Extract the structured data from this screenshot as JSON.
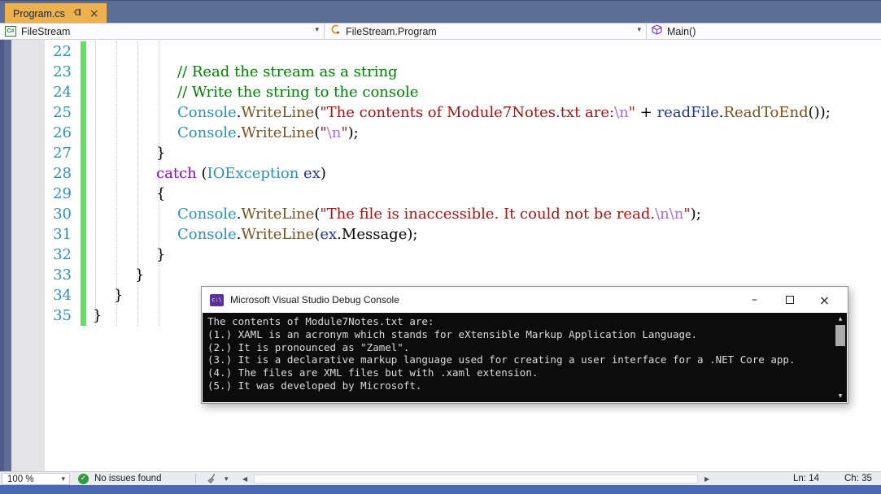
{
  "tab_bar": {
    "tabs": [
      {
        "label": "Program.cs",
        "active": true
      }
    ]
  },
  "navbar": {
    "project": "FileStream",
    "type": "FileStream.Program",
    "member": "Main()"
  },
  "editor": {
    "lines": [
      {
        "num": "22",
        "indent": 0,
        "tokens": []
      },
      {
        "num": "23",
        "indent": 16,
        "tokens": [
          {
            "c": "comment",
            "t": "// Read the stream as a string"
          }
        ]
      },
      {
        "num": "24",
        "indent": 16,
        "tokens": [
          {
            "c": "comment",
            "t": "// Write the string to the console"
          }
        ]
      },
      {
        "num": "25",
        "indent": 16,
        "tokens": [
          {
            "c": "type",
            "t": "Console"
          },
          {
            "c": "plain",
            "t": "."
          },
          {
            "c": "method",
            "t": "WriteLine"
          },
          {
            "c": "plain",
            "t": "("
          },
          {
            "c": "string",
            "t": "\"The contents of Module7Notes.txt are:"
          },
          {
            "c": "escape",
            "t": "\\n"
          },
          {
            "c": "string",
            "t": "\""
          },
          {
            "c": "plain",
            "t": " + "
          },
          {
            "c": "local",
            "t": "readFile"
          },
          {
            "c": "plain",
            "t": "."
          },
          {
            "c": "method",
            "t": "ReadToEnd"
          },
          {
            "c": "plain",
            "t": "());"
          }
        ]
      },
      {
        "num": "26",
        "indent": 16,
        "tokens": [
          {
            "c": "type",
            "t": "Console"
          },
          {
            "c": "plain",
            "t": "."
          },
          {
            "c": "method",
            "t": "WriteLine"
          },
          {
            "c": "plain",
            "t": "("
          },
          {
            "c": "string",
            "t": "\""
          },
          {
            "c": "escape",
            "t": "\\n"
          },
          {
            "c": "string",
            "t": "\""
          },
          {
            "c": "plain",
            "t": ");"
          }
        ]
      },
      {
        "num": "27",
        "indent": 12,
        "tokens": [
          {
            "c": "plain",
            "t": "}"
          }
        ]
      },
      {
        "num": "28",
        "indent": 12,
        "tokens": [
          {
            "c": "keyword",
            "t": "catch"
          },
          {
            "c": "plain",
            "t": " ("
          },
          {
            "c": "type",
            "t": "IOException"
          },
          {
            "c": "local",
            "t": " ex"
          },
          {
            "c": "plain",
            "t": ")"
          }
        ]
      },
      {
        "num": "29",
        "indent": 12,
        "tokens": [
          {
            "c": "plain",
            "t": "{"
          }
        ]
      },
      {
        "num": "30",
        "indent": 16,
        "tokens": [
          {
            "c": "type",
            "t": "Console"
          },
          {
            "c": "plain",
            "t": "."
          },
          {
            "c": "method",
            "t": "WriteLine"
          },
          {
            "c": "plain",
            "t": "("
          },
          {
            "c": "string",
            "t": "\"The file is inaccessible. It could not be read."
          },
          {
            "c": "escape",
            "t": "\\n\\n"
          },
          {
            "c": "string",
            "t": "\""
          },
          {
            "c": "plain",
            "t": ");"
          }
        ]
      },
      {
        "num": "31",
        "indent": 16,
        "tokens": [
          {
            "c": "type",
            "t": "Console"
          },
          {
            "c": "plain",
            "t": "."
          },
          {
            "c": "method",
            "t": "WriteLine"
          },
          {
            "c": "plain",
            "t": "("
          },
          {
            "c": "local",
            "t": "ex"
          },
          {
            "c": "plain",
            "t": ".Message);"
          }
        ]
      },
      {
        "num": "32",
        "indent": 12,
        "tokens": [
          {
            "c": "plain",
            "t": "}"
          }
        ]
      },
      {
        "num": "33",
        "indent": 8,
        "tokens": [
          {
            "c": "plain",
            "t": "}"
          }
        ]
      },
      {
        "num": "34",
        "indent": 4,
        "tokens": [
          {
            "c": "plain",
            "t": "}"
          }
        ]
      },
      {
        "num": "35",
        "indent": 0,
        "tokens": [
          {
            "c": "plain",
            "t": "}"
          }
        ]
      }
    ]
  },
  "debug_console": {
    "title": "Microsoft Visual Studio Debug Console",
    "badge": "c:\\",
    "output": [
      "The contents of Module7Notes.txt are:",
      "(1.) XAML is an acronym which stands for eXtensible Markup Application Language.",
      "(2.) It is pronounced as \"Zamel\".",
      "(3.) It is a declarative markup language used for creating a user interface for a .NET Core app.",
      "(4.) The files are XML files but with .xaml extension.",
      "(5.) It was developed by Microsoft."
    ]
  },
  "status_bar": {
    "zoom": "100 %",
    "issues": "No issues found",
    "line": "Ln: 14",
    "column": "Ch: 35"
  },
  "icons": {
    "csharp_badge": "C#",
    "chevron_down": "▾",
    "close": "×",
    "minimize": "–",
    "check": "✓",
    "scroll_left": "◀",
    "scroll_right": "▶",
    "scroll_up": "▲",
    "scroll_down": "▼"
  },
  "colors": {
    "top_strip": "#5d6e95",
    "tab_active": "#edb24c",
    "line_number": "#2b91af",
    "change_bar": "#62de62",
    "comment": "#008000",
    "string": "#a31515",
    "escape": "#a96fe3",
    "keyword": "#8f08c4",
    "type": "#2b91af",
    "method": "#74531f",
    "local_variable": "#1f377f",
    "console_background": "#0c0c0c",
    "console_text": "#dcdcdc",
    "status_strip_blue": "#4a69b2",
    "issues_check_green": "#309b3f"
  }
}
